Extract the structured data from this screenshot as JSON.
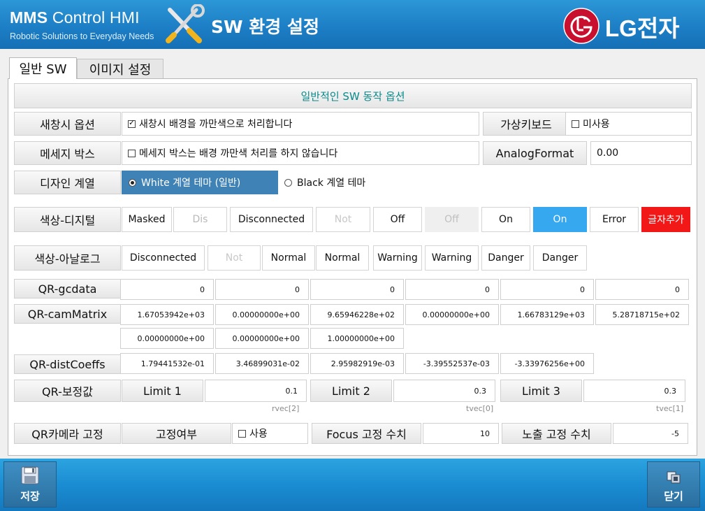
{
  "header": {
    "app_title_bold": "MMS",
    "app_title_rest": "Control HMI",
    "app_subtitle": "Robotic Solutions to Everyday Needs",
    "page_title": "SW 환경 설정",
    "brand_text": "LG전자"
  },
  "tabs": [
    {
      "label": "일반 SW",
      "selected": true
    },
    {
      "label": "이미지 설정",
      "selected": false
    }
  ],
  "general": {
    "section_title": "일반적인 SW 동작 옵션",
    "new_window": {
      "label": "새창시 옵션",
      "checked": true,
      "text": "새창시 배경을 까만색으로 처리합니다"
    },
    "virtual_keyboard": {
      "label": "가상키보드",
      "checked": false,
      "text": "미사용"
    },
    "message_box": {
      "label": "메세지 박스",
      "checked": false,
      "text": "메세지 박스는 배경 까만색 처리를 하지 않습니다"
    },
    "analog_format": {
      "label": "AnalogFormat",
      "value": "0.00"
    },
    "design": {
      "label": "디자인 계열",
      "options": [
        "White 계열 테마 (일반)",
        "Black 계열 테마"
      ],
      "selected": 0
    },
    "color_digital": {
      "label": "색상-디지털",
      "chips": [
        {
          "text": "Masked",
          "bg": "#ffffff",
          "fg": "#111111"
        },
        {
          "text": "Dis",
          "bg": "#ffffff",
          "fg": "#b8b8b8"
        },
        {
          "text": "Disconnected",
          "bg": "#ffffff",
          "fg": "#111111"
        },
        {
          "text": "Not",
          "bg": "#ffffff",
          "fg": "#c8c8c8"
        },
        {
          "text": "Off",
          "bg": "#ffffff",
          "fg": "#111111"
        },
        {
          "text": "Off",
          "bg": "#efefef",
          "fg": "#c0c0c0"
        },
        {
          "text": "On",
          "bg": "#ffffff",
          "fg": "#111111"
        },
        {
          "text": "On",
          "bg": "#35a8f0",
          "fg": "#ffffff"
        },
        {
          "text": "Error",
          "bg": "#ffffff",
          "fg": "#111111"
        },
        {
          "text": "글자추가",
          "bg": "#f21818",
          "fg": "#ffffff"
        }
      ]
    },
    "color_analog": {
      "label": "색상-아날로그",
      "chips": [
        {
          "text": "Disconnected",
          "bg": "#ffffff",
          "fg": "#111111"
        },
        {
          "text": "Not",
          "bg": "#ffffff",
          "fg": "#c8c8c8"
        },
        {
          "text": "Normal",
          "bg": "#ffffff",
          "fg": "#111111"
        },
        {
          "text": "Normal",
          "bg": "#ffffff",
          "fg": "#111111"
        },
        {
          "text": "Warning",
          "bg": "#ffffff",
          "fg": "#111111"
        },
        {
          "text": "Warning",
          "bg": "#ffffff",
          "fg": "#111111"
        },
        {
          "text": "Danger",
          "bg": "#ffffff",
          "fg": "#111111"
        },
        {
          "text": "Danger",
          "bg": "#ffffff",
          "fg": "#111111"
        }
      ]
    },
    "qr_gcdata": {
      "label": "QR-gcdata",
      "values": [
        "0",
        "0",
        "0",
        "0",
        "0",
        "0"
      ]
    },
    "qr_cammatrix": {
      "label": "QR-camMatrix",
      "row1": [
        "1.67053942e+03",
        "0.00000000e+00",
        "9.65946228e+02",
        "0.00000000e+00",
        "1.66783129e+03",
        "5.28718715e+02"
      ],
      "row2": [
        "0.00000000e+00",
        "0.00000000e+00",
        "1.00000000e+00"
      ]
    },
    "qr_distcoeffs": {
      "label": "QR-distCoeffs",
      "values": [
        "1.79441532e-01",
        "3.46899031e-02",
        "2.95982919e-03",
        "-3.39552537e-03",
        "-3.33976256e+00"
      ]
    },
    "qr_correction": {
      "label": "QR-보정값",
      "limits": [
        {
          "label": "Limit 1",
          "value": "0.1",
          "sub": "rvec[2]"
        },
        {
          "label": "Limit 2",
          "value": "0.3",
          "sub": "tvec[0]"
        },
        {
          "label": "Limit 3",
          "value": "0.3",
          "sub": "tvec[1]"
        }
      ]
    },
    "qr_camera_fix": {
      "label": "QR카메라 고정",
      "fix_label": "고정여부",
      "fix_checked": false,
      "fix_text": "사용",
      "focus_label": "Focus 고정 수치",
      "focus_value": "10",
      "exposure_label": "노출 고정 수치",
      "exposure_value": "-5"
    }
  },
  "footer": {
    "save_label": "저장",
    "close_label": "닫기"
  }
}
